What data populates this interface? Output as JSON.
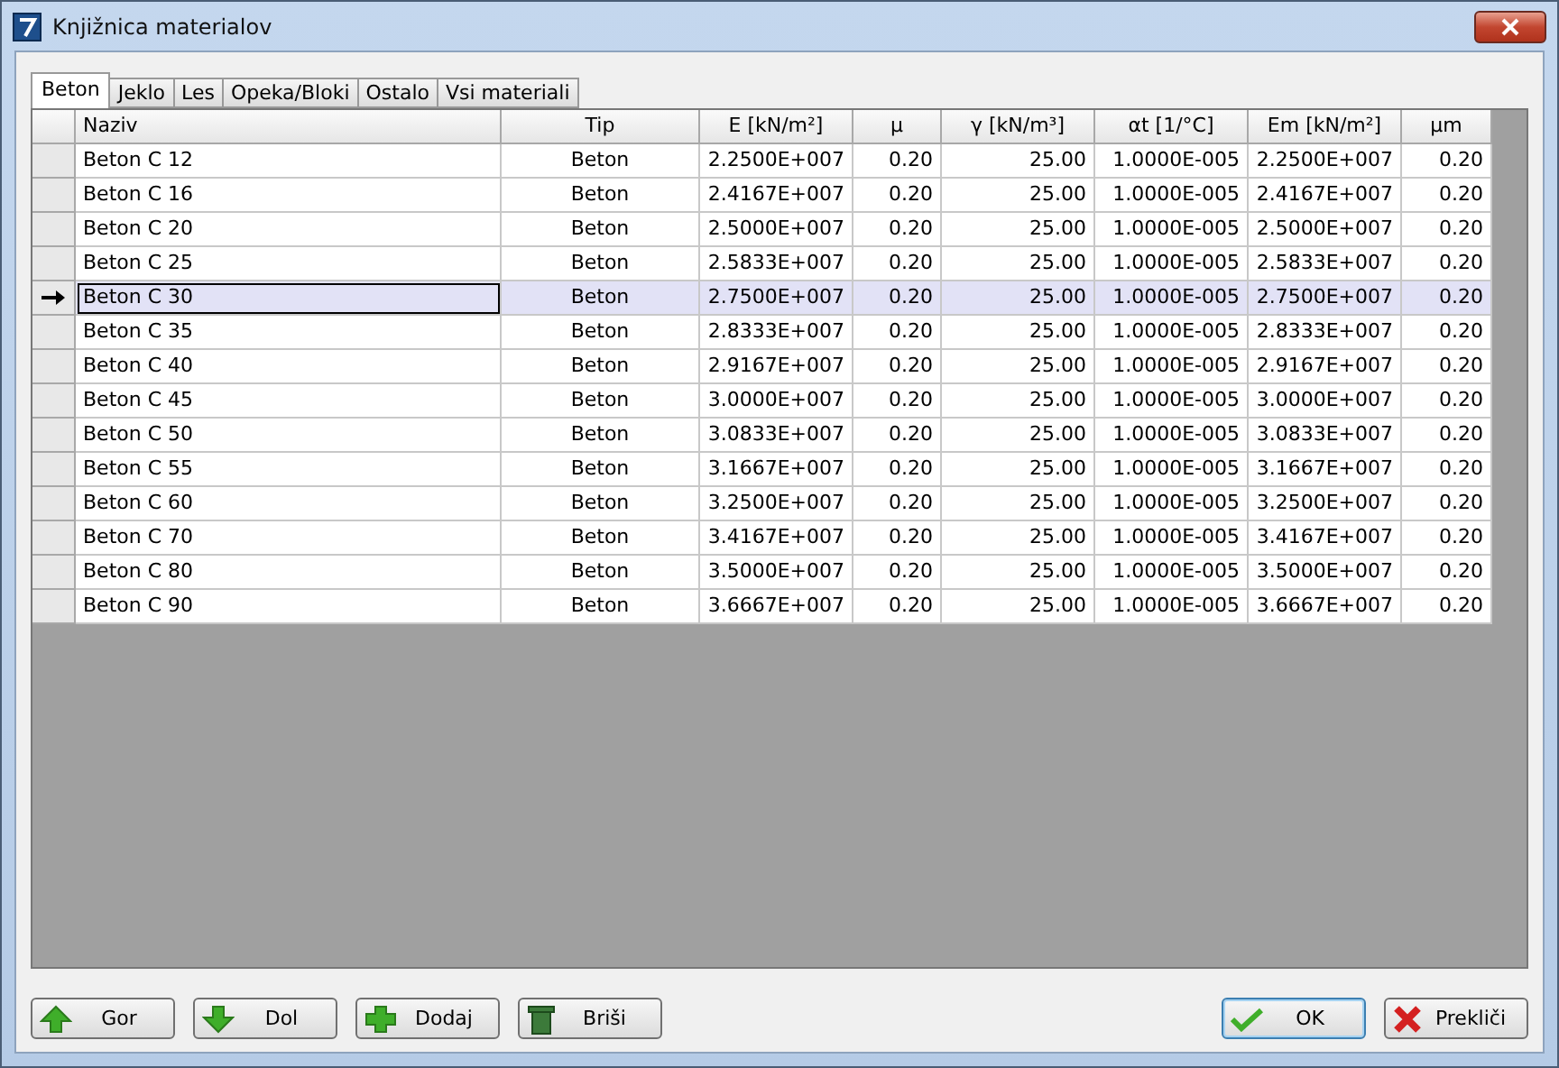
{
  "window": {
    "title": "Knjižnica materialov"
  },
  "tabs": [
    {
      "label": "Beton",
      "selected": true
    },
    {
      "label": "Jeklo",
      "selected": false
    },
    {
      "label": "Les",
      "selected": false
    },
    {
      "label": "Opeka/Bloki",
      "selected": false
    },
    {
      "label": "Ostalo",
      "selected": false
    },
    {
      "label": "Vsi materiali",
      "selected": false
    }
  ],
  "table": {
    "columns": [
      "Naziv",
      "Tip",
      "E [kN/m²]",
      "µ",
      "γ [kN/m³]",
      "αt [1/°C]",
      "Em [kN/m²]",
      "µm"
    ],
    "rows": [
      {
        "selected": false,
        "cells": [
          "Beton C 12",
          "Beton",
          "2.2500E+007",
          "0.20",
          "25.00",
          "1.0000E-005",
          "2.2500E+007",
          "0.20"
        ]
      },
      {
        "selected": false,
        "cells": [
          "Beton C 16",
          "Beton",
          "2.4167E+007",
          "0.20",
          "25.00",
          "1.0000E-005",
          "2.4167E+007",
          "0.20"
        ]
      },
      {
        "selected": false,
        "cells": [
          "Beton C 20",
          "Beton",
          "2.5000E+007",
          "0.20",
          "25.00",
          "1.0000E-005",
          "2.5000E+007",
          "0.20"
        ]
      },
      {
        "selected": false,
        "cells": [
          "Beton C 25",
          "Beton",
          "2.5833E+007",
          "0.20",
          "25.00",
          "1.0000E-005",
          "2.5833E+007",
          "0.20"
        ]
      },
      {
        "selected": true,
        "cells": [
          "Beton C 30",
          "Beton",
          "2.7500E+007",
          "0.20",
          "25.00",
          "1.0000E-005",
          "2.7500E+007",
          "0.20"
        ]
      },
      {
        "selected": false,
        "cells": [
          "Beton C 35",
          "Beton",
          "2.8333E+007",
          "0.20",
          "25.00",
          "1.0000E-005",
          "2.8333E+007",
          "0.20"
        ]
      },
      {
        "selected": false,
        "cells": [
          "Beton C 40",
          "Beton",
          "2.9167E+007",
          "0.20",
          "25.00",
          "1.0000E-005",
          "2.9167E+007",
          "0.20"
        ]
      },
      {
        "selected": false,
        "cells": [
          "Beton C 45",
          "Beton",
          "3.0000E+007",
          "0.20",
          "25.00",
          "1.0000E-005",
          "3.0000E+007",
          "0.20"
        ]
      },
      {
        "selected": false,
        "cells": [
          "Beton C 50",
          "Beton",
          "3.0833E+007",
          "0.20",
          "25.00",
          "1.0000E-005",
          "3.0833E+007",
          "0.20"
        ]
      },
      {
        "selected": false,
        "cells": [
          "Beton C 55",
          "Beton",
          "3.1667E+007",
          "0.20",
          "25.00",
          "1.0000E-005",
          "3.1667E+007",
          "0.20"
        ]
      },
      {
        "selected": false,
        "cells": [
          "Beton C 60",
          "Beton",
          "3.2500E+007",
          "0.20",
          "25.00",
          "1.0000E-005",
          "3.2500E+007",
          "0.20"
        ]
      },
      {
        "selected": false,
        "cells": [
          "Beton C 70",
          "Beton",
          "3.4167E+007",
          "0.20",
          "25.00",
          "1.0000E-005",
          "3.4167E+007",
          "0.20"
        ]
      },
      {
        "selected": false,
        "cells": [
          "Beton C 80",
          "Beton",
          "3.5000E+007",
          "0.20",
          "25.00",
          "1.0000E-005",
          "3.5000E+007",
          "0.20"
        ]
      },
      {
        "selected": false,
        "cells": [
          "Beton C 90",
          "Beton",
          "3.6667E+007",
          "0.20",
          "25.00",
          "1.0000E-005",
          "3.6667E+007",
          "0.20"
        ]
      }
    ]
  },
  "left_buttons": [
    {
      "kind": "up",
      "label": "Gor"
    },
    {
      "kind": "down",
      "label": "Dol"
    },
    {
      "kind": "add",
      "label": "Dodaj"
    },
    {
      "kind": "delete",
      "label": "Briši"
    }
  ],
  "right_buttons": [
    {
      "kind": "ok",
      "label": "OK"
    },
    {
      "kind": "cancel",
      "label": "Prekliči"
    }
  ]
}
